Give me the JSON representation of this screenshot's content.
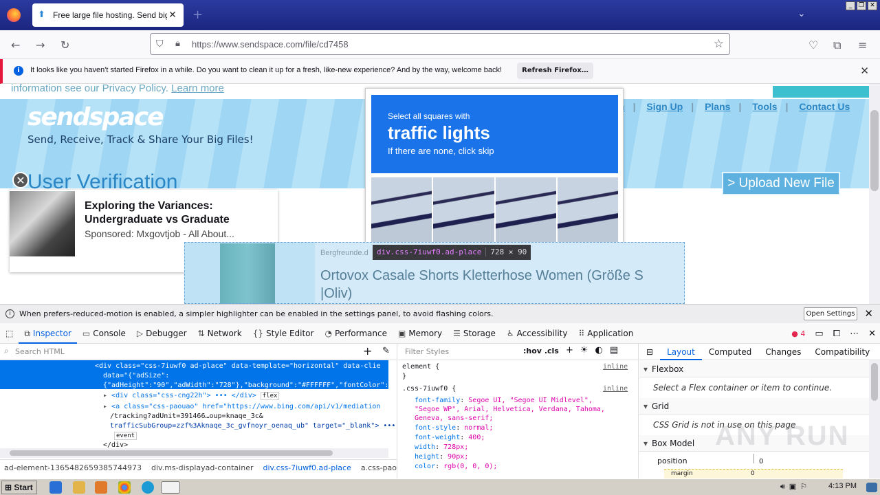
{
  "browser": {
    "tab_title": "Free large file hosting. Send big fil",
    "url": "https://www.sendspace.com/file/cd7458"
  },
  "notification": {
    "message": "It looks like you haven't started Firefox in a while. Do you want to clean it up for a fresh, like-new experience? And by the way, welcome back!",
    "button": "Refresh Firefox…"
  },
  "site": {
    "privacy_text": "information see our Privacy Policy.",
    "learn_more": "Learn more",
    "logo": "sendspace",
    "tagline": "Send, Receive, Track & Share Your Big Files!",
    "nav": [
      "n",
      "Sign Up",
      "Plans",
      "Tools",
      "Contact Us"
    ],
    "upload_button": "> Upload New File",
    "verification_title": "User Verification"
  },
  "ad_sponsored": {
    "title": "Exploring the Variances: Undergraduate vs Graduate",
    "sponsor": "Sponsored: Mxgovtjob - All About..."
  },
  "captcha": {
    "line1": "Select all squares with",
    "line2": "traffic lights",
    "line3": "If there are none, click skip"
  },
  "ad_banner": {
    "brand": "Bergfreunde.d",
    "title": "Ortovox Casale Shorts Kletterhose Women (Größe S |Oliv)"
  },
  "highlighter": {
    "selector": "div.css-7iuwf0.ad-place",
    "size": "728 × 90"
  },
  "devtools": {
    "reduced_motion_msg": "When prefers-reduced-motion is enabled, a simpler highlighter can be enabled in the settings panel, to avoid flashing colors.",
    "open_settings": "Open Settings",
    "tabs": [
      "Inspector",
      "Console",
      "Debugger",
      "Network",
      "Style Editor",
      "Performance",
      "Memory",
      "Storage",
      "Accessibility",
      "Application"
    ],
    "error_count": "4",
    "search_placeholder": "Search HTML",
    "markup": {
      "line1": "<div class=\"css-7iuwf0 ad-place\" data-template=\"horizontal\" data-clie",
      "line2": "data=\"{\"adSize\":",
      "line3": "{\"adHeight\":\"90\",\"adWidth\":\"728\"},\"background\":\"#FFFFFF\",\"fontColor\":",
      "line4": "<div class=\"css-cng22h\"> ••• </div>",
      "line4_badge": "flex",
      "line5": "<a class=\"css-paouao\" href=\"https://www.bing.com/api/v1/mediation",
      "line6": "/tracking?adUnit=391466…oup=knaqe_3c&",
      "line7": "trafficSubGroup=zzf%3Aknaqe_3c_gvfnoyr_oenaq_ub\" target=\"_blank\"> •••",
      "line7_badge": "event",
      "line8": "</div>"
    },
    "breadcrumbs": [
      "ad-element-1365482659385744973",
      "div.ms-displayad-container",
      "div.css-7iuwf0.ad-place",
      "a.css-paouao"
    ],
    "rules": {
      "filter_placeholder": "Filter Styles",
      "hov": ":hov",
      "cls": ".cls",
      "element": "element",
      "inline": "inline",
      "rule_selector": ".css-7iuwf0",
      "props": [
        {
          "name": "font-family",
          "value": "Segoe UI, \"Segoe UI Midlevel\", \"Segoe WP\", Arial, Helvetica, Verdana, Tahoma, Geneva, sans-serif;"
        },
        {
          "name": "font-style",
          "value": "normal;"
        },
        {
          "name": "font-weight",
          "value": "400;"
        },
        {
          "name": "width",
          "value": "728px;"
        },
        {
          "name": "height",
          "value": "90px;"
        },
        {
          "name": "color",
          "value": "rgb(0, 0, 0);"
        }
      ]
    },
    "layout": {
      "tabs": [
        "Layout",
        "Computed",
        "Changes",
        "Compatibility"
      ],
      "flexbox": "Flexbox",
      "flexbox_msg": "Select a Flex container or item to continue.",
      "grid": "Grid",
      "grid_msg": "CSS Grid is not in use on this page",
      "boxmodel": "Box Model",
      "position_label": "position",
      "position_value": "0",
      "margin_label": "margin",
      "margin_value": "0"
    }
  },
  "taskbar": {
    "start": "Start",
    "clock": "4:13 PM"
  },
  "watermark": "ANY RUN"
}
